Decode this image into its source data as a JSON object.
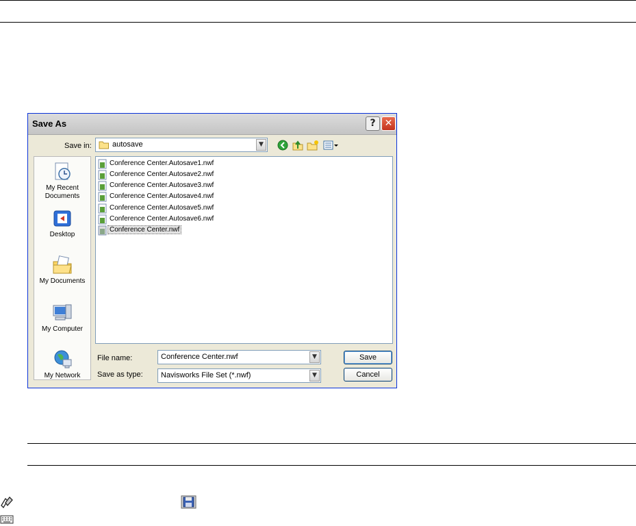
{
  "dialog": {
    "title": "Save As",
    "help_label": "?",
    "close_label": "✕",
    "save_in_label": "Save in:",
    "save_in_value": "autosave",
    "places": [
      {
        "label_line1": "My Recent",
        "label_line2": "Documents",
        "icon": "my-recent-documents-icon"
      },
      {
        "label_line1": "Desktop",
        "label_line2": "",
        "icon": "desktop-icon"
      },
      {
        "label_line1": "My Documents",
        "label_line2": "",
        "icon": "my-documents-icon"
      },
      {
        "label_line1": "My Computer",
        "label_line2": "",
        "icon": "my-computer-icon"
      },
      {
        "label_line1": "My Network",
        "label_line2": "",
        "icon": "my-network-icon"
      }
    ],
    "files": [
      {
        "name": "Conference Center.Autosave1.nwf"
      },
      {
        "name": "Conference Center.Autosave2.nwf"
      },
      {
        "name": "Conference Center.Autosave3.nwf"
      },
      {
        "name": "Conference Center.Autosave4.nwf"
      },
      {
        "name": "Conference Center.Autosave5.nwf"
      },
      {
        "name": "Conference Center.Autosave6.nwf"
      },
      {
        "name": "Conference Center.nwf",
        "selected": true
      }
    ],
    "file_name_label": "File name:",
    "file_name_value": "Conference Center.nwf",
    "save_as_type_label": "Save as type:",
    "save_as_type_value": "Navisworks File Set (*.nwf)",
    "save_button": "Save",
    "cancel_button": "Cancel"
  },
  "colors": {
    "dialog_bg": "#ece9d8",
    "border_blue": "#7f9db9",
    "close_red": "#c4341e"
  },
  "icons": [
    "go-back-icon",
    "up-folder-icon",
    "new-folder-icon",
    "views-menu-icon",
    "folder-icon",
    "nwf-file-icon",
    "ribbon-icon",
    "save-icon",
    "keyboard-icon"
  ]
}
